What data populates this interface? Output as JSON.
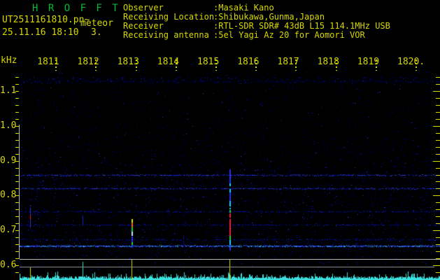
{
  "header": {
    "title": "H R O F F T",
    "filename": "UT2511161810.pn~",
    "overlay_label": "meteor",
    "datetime": "25.11.16 18:10",
    "counter": "3."
  },
  "info": {
    "rows": [
      {
        "label": "Observer",
        "value": ":Masaki Kano"
      },
      {
        "label": "Receiving Location",
        "value": ":Shibukawa,Gunma,Japan"
      },
      {
        "label": "Receiver",
        "value": ":RTL-SDR SDR# 43dB L15 114.1MHz USB"
      },
      {
        "label": "Receiving antenna",
        "value": ":5el Yagi Az 20 for Aomori VOR"
      }
    ]
  },
  "chart_data": {
    "type": "heatmap",
    "title": "HROFFT 10-minute meteor-radio spectrogram",
    "x_axis": {
      "unit_label": "kHz",
      "start_time": "18:10",
      "minutes_span": 10,
      "tick_labels": [
        "1811",
        "1812",
        "1813",
        "1814",
        "1815",
        "1816",
        "1817",
        "1818",
        "1819",
        "1820."
      ]
    },
    "y_axis": {
      "unit": "kHz",
      "tick_labels": [
        "1.1",
        "1.0",
        "0.9",
        "0.8",
        "0.7",
        "0.6"
      ],
      "range_khz": [
        0.62,
        1.15
      ]
    },
    "carrier_lines": [
      {
        "freq_khz": 1.128,
        "strength": "trace"
      },
      {
        "freq_khz": 0.86,
        "strength": "medium"
      },
      {
        "freq_khz": 0.82,
        "strength": "medium"
      },
      {
        "freq_khz": 0.755,
        "strength": "faint"
      },
      {
        "freq_khz": 0.717,
        "strength": "faint"
      },
      {
        "freq_khz": 0.675,
        "strength": "faint"
      },
      {
        "freq_khz": 0.657,
        "strength": "strong"
      }
    ],
    "meteor_echoes": [
      {
        "t_min": 0.37,
        "width": 1,
        "segments": [
          {
            "f0": 0.773,
            "f1": 0.745,
            "color": "#2233ee"
          },
          {
            "f0": 0.745,
            "f1": 0.733,
            "color": "#ee2222"
          },
          {
            "f0": 0.733,
            "f1": 0.708,
            "color": "#2233ee"
          }
        ]
      },
      {
        "t_min": 1.68,
        "width": 1,
        "segments": [
          {
            "f0": 0.743,
            "f1": 0.714,
            "color": "#1122bb"
          }
        ]
      },
      {
        "t_min": 2.9,
        "width": 2,
        "segments": [
          {
            "f0": 0.733,
            "f1": 0.722,
            "color": "#dddd22"
          },
          {
            "f0": 0.722,
            "f1": 0.708,
            "color": "#ee6611"
          },
          {
            "f0": 0.708,
            "f1": 0.696,
            "color": "#22cc33"
          },
          {
            "f0": 0.696,
            "f1": 0.686,
            "color": "#cfe6ff"
          },
          {
            "f0": 0.686,
            "f1": 0.666,
            "color": "#2233dd"
          },
          {
            "f0": 0.666,
            "f1": 0.658,
            "color": "#22cc33"
          },
          {
            "f0": 0.658,
            "f1": 0.651,
            "color": "#2233dd"
          }
        ]
      },
      {
        "t_min": 4.2,
        "width": 1,
        "segments": [
          {
            "f0": 0.69,
            "f1": 0.655,
            "color": "#000f99"
          }
        ]
      },
      {
        "t_min": 5.35,
        "width": 2,
        "segments": [
          {
            "f0": 0.879,
            "f1": 0.835,
            "color": "#2233ee"
          },
          {
            "f0": 0.835,
            "f1": 0.809,
            "color": "#22ccee"
          },
          {
            "f0": 0.809,
            "f1": 0.785,
            "color": "#2233ee"
          },
          {
            "f0": 0.785,
            "f1": 0.763,
            "color": "#22ccee"
          },
          {
            "f0": 0.763,
            "f1": 0.749,
            "color": "#22cc33"
          },
          {
            "f0": 0.749,
            "f1": 0.684,
            "color": "#ee2233"
          },
          {
            "f0": 0.684,
            "f1": 0.672,
            "color": "#22cc33"
          },
          {
            "f0": 0.672,
            "f1": 0.658,
            "color": "#22ccee"
          },
          {
            "f0": 0.658,
            "f1": 0.644,
            "color": "#2233ee"
          }
        ]
      }
    ],
    "activity_strip": {
      "events": [
        {
          "t_min": 0.37,
          "marker": "yellow",
          "extent": "half"
        },
        {
          "t_min": 1.68,
          "marker": "cyan",
          "extent": "half"
        },
        {
          "t_min": 2.9,
          "marker": "yellow",
          "extent": "full"
        },
        {
          "t_min": 5.35,
          "marker": "yellow",
          "extent": "full"
        }
      ]
    },
    "colors": {
      "axis_text": "#d8d800",
      "title_text": "#00bb33",
      "noise_graph": "#3ce0e0",
      "border_line": "#b8b8b8",
      "sub_line": "#8a8a8a",
      "background": "#000000"
    }
  }
}
